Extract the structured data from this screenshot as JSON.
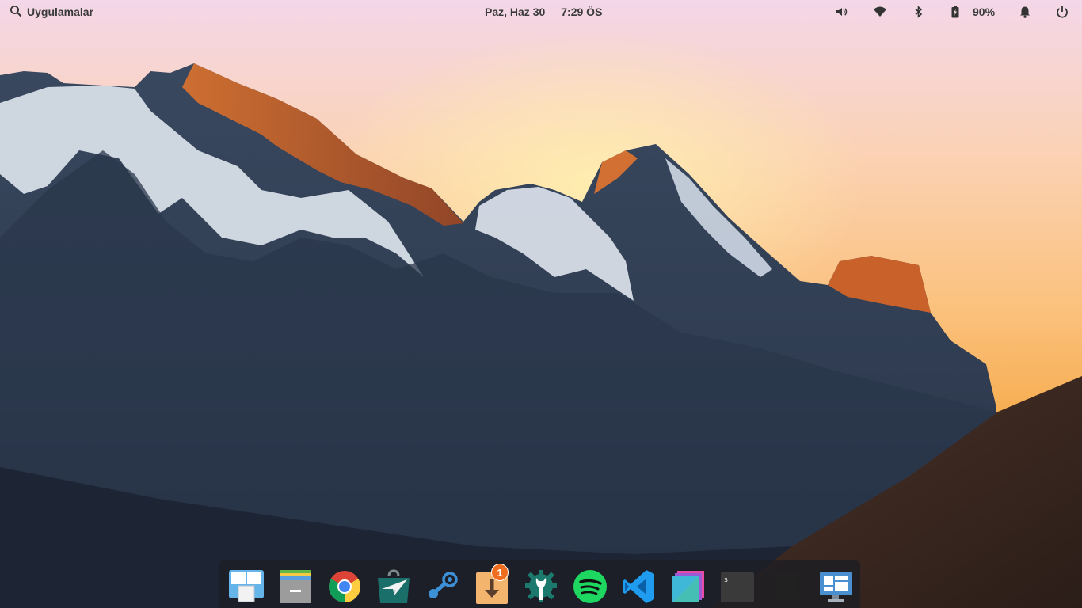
{
  "panel": {
    "applications_label": "Uygulamalar",
    "date": "Paz, Haz 30",
    "time": "7:29 ÖS",
    "battery_percent": "90%",
    "indicators": [
      "volume-icon",
      "wifi-icon",
      "bluetooth-icon",
      "battery-icon",
      "notifications-icon",
      "power-icon"
    ]
  },
  "dock": {
    "items": [
      {
        "name": "multitasking-view",
        "icon": "multitasking-view-icon",
        "running": false
      },
      {
        "name": "files",
        "icon": "files-icon",
        "running": false
      },
      {
        "name": "chrome",
        "icon": "chrome-icon",
        "running": true
      },
      {
        "name": "appcenter",
        "icon": "appcenter-icon",
        "running": false
      },
      {
        "name": "steam",
        "icon": "steam-icon",
        "running": false
      },
      {
        "name": "updates",
        "icon": "updates-icon",
        "running": false,
        "badge": "1"
      },
      {
        "name": "system-settings",
        "icon": "settings-icon",
        "running": true
      },
      {
        "name": "spotify",
        "icon": "spotify-icon",
        "running": true
      },
      {
        "name": "vscode",
        "icon": "vscode-icon",
        "running": false
      },
      {
        "name": "photo-app",
        "icon": "photos-icon",
        "running": false
      },
      {
        "name": "terminal",
        "icon": "terminal-icon",
        "running": false
      },
      {
        "name": "blank-app",
        "icon": "blank-window-icon",
        "running": true
      },
      {
        "name": "monitor-app",
        "icon": "monitor-icon",
        "running": true
      }
    ]
  },
  "colors": {
    "sky_top": "#f6d6e6",
    "sky_mid": "#fbc38a",
    "sky_horizon": "#f7b253",
    "mountain_dark": "#2d3d55",
    "snow": "#dfe6ef",
    "dock_bg": "#1c1e24",
    "running_dot": "#8fd3ff"
  }
}
